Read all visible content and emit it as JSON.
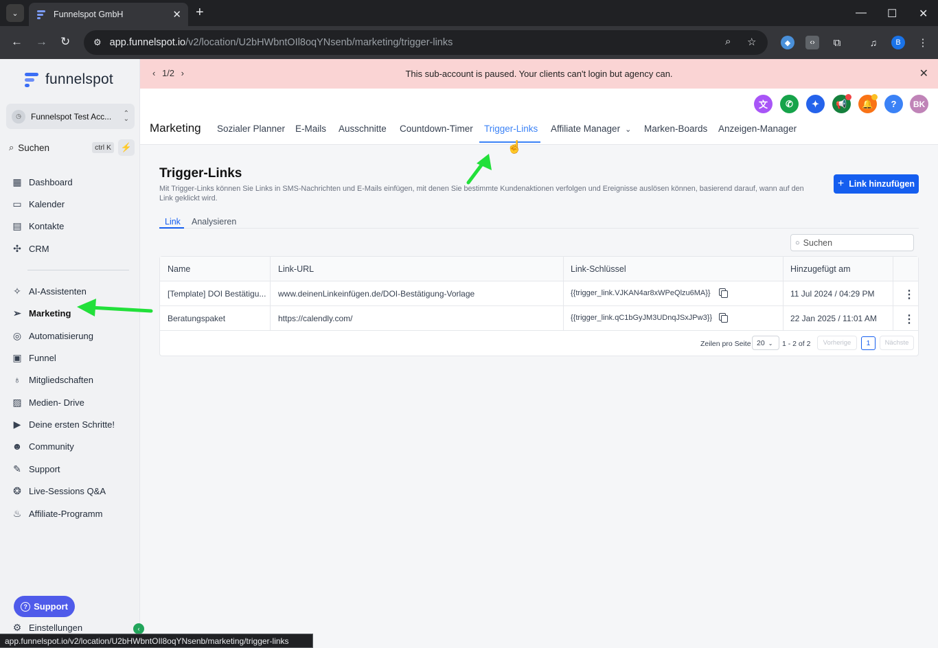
{
  "browser": {
    "tab_title": "Funnelspot GmbH",
    "url_host": "app.funnelspot.io",
    "url_path": "/v2/location/U2bHWbntOIl8oqYNsenb/marketing/trigger-links",
    "profile_initial": "B",
    "status_url": "app.funnelspot.io/v2/location/U2bHWbntOIl8oqYNsenb/marketing/trigger-links"
  },
  "sidebar": {
    "brand": "funnelspot",
    "account_name": "Funnelspot Test Acc...",
    "search_label": "Suchen",
    "search_shortcut": "ctrl K",
    "items": [
      {
        "label": "Dashboard",
        "icon": "grid-icon"
      },
      {
        "label": "Kalender",
        "icon": "calendar-icon"
      },
      {
        "label": "Kontakte",
        "icon": "contacts-icon"
      },
      {
        "label": "CRM",
        "icon": "crm-icon"
      },
      {
        "label": "AI-Assistenten",
        "icon": "sparkle-icon"
      },
      {
        "label": "Marketing",
        "icon": "send-icon"
      },
      {
        "label": "Automatisierung",
        "icon": "automation-icon"
      },
      {
        "label": "Funnel",
        "icon": "funnel-icon"
      },
      {
        "label": "Mitgliedschaften",
        "icon": "membership-icon"
      },
      {
        "label": "Medien- Drive",
        "icon": "image-icon"
      },
      {
        "label": "Deine ersten Schritte!",
        "icon": "play-icon"
      },
      {
        "label": "Community",
        "icon": "users-icon"
      },
      {
        "label": "Support",
        "icon": "wrench-icon"
      },
      {
        "label": "Live-Sessions Q&A",
        "icon": "chat-icon"
      },
      {
        "label": "Affiliate-Programm",
        "icon": "hand-coin-icon"
      }
    ],
    "support_button": "Support",
    "settings_label": "Einstellungen"
  },
  "banner": {
    "pager": "1/2",
    "message": "This sub-account is paused. Your clients can't login but agency can."
  },
  "header": {
    "title": "Marketing",
    "tabs": [
      "Sozialer Planner",
      "E-Mails",
      "Ausschnitte",
      "Countdown-Timer",
      "Trigger-Links",
      "Affiliate Manager",
      "Marken-Boards",
      "Anzeigen-Manager"
    ],
    "active_tab": "Trigger-Links",
    "user_initials": "BK",
    "icon_colors": {
      "translate": "#a855f7",
      "phone": "#16a34a",
      "ai": "#2563eb",
      "megaphone": "#15803d",
      "bell": "#f97316",
      "help": "#3b82f6",
      "avatar": "#c084b8"
    }
  },
  "main": {
    "title": "Trigger-Links",
    "description": "Mit Trigger-Links können Sie Links in SMS-Nachrichten und E-Mails einfügen, mit denen Sie bestimmte Kundenaktionen verfolgen und Ereignisse auslösen können, basierend darauf, wann auf den Link geklickt wird.",
    "add_button": "Link hinzufügen",
    "subtabs": [
      "Link",
      "Analysieren"
    ],
    "search_placeholder": "Suchen",
    "table": {
      "columns": [
        "Name",
        "Link-URL",
        "Link-Schlüssel",
        "Hinzugefügt am"
      ],
      "rows": [
        {
          "name": "[Template] DOI Bestätigu...",
          "url": "www.deinenLinkeinfügen.de/DOI-Bestätigung-Vorlage",
          "key": "{{trigger_link.VJKAN4ar8xWPeQlzu6MA}}",
          "added": "11 Jul 2024 / 04:29 PM"
        },
        {
          "name": "Beratungspaket",
          "url": "https://calendly.com/",
          "key": "{{trigger_link.qC1bGyJM3UDnqJSxJPw3}}",
          "added": "22 Jan 2025 / 11:01 AM"
        }
      ]
    },
    "pagination": {
      "rows_per_page_label": "Zeilen pro Seite",
      "rows_per_page": "20",
      "range": "1 - 2 of 2",
      "prev": "Vorherige",
      "current": "1",
      "next": "Nächste"
    }
  }
}
